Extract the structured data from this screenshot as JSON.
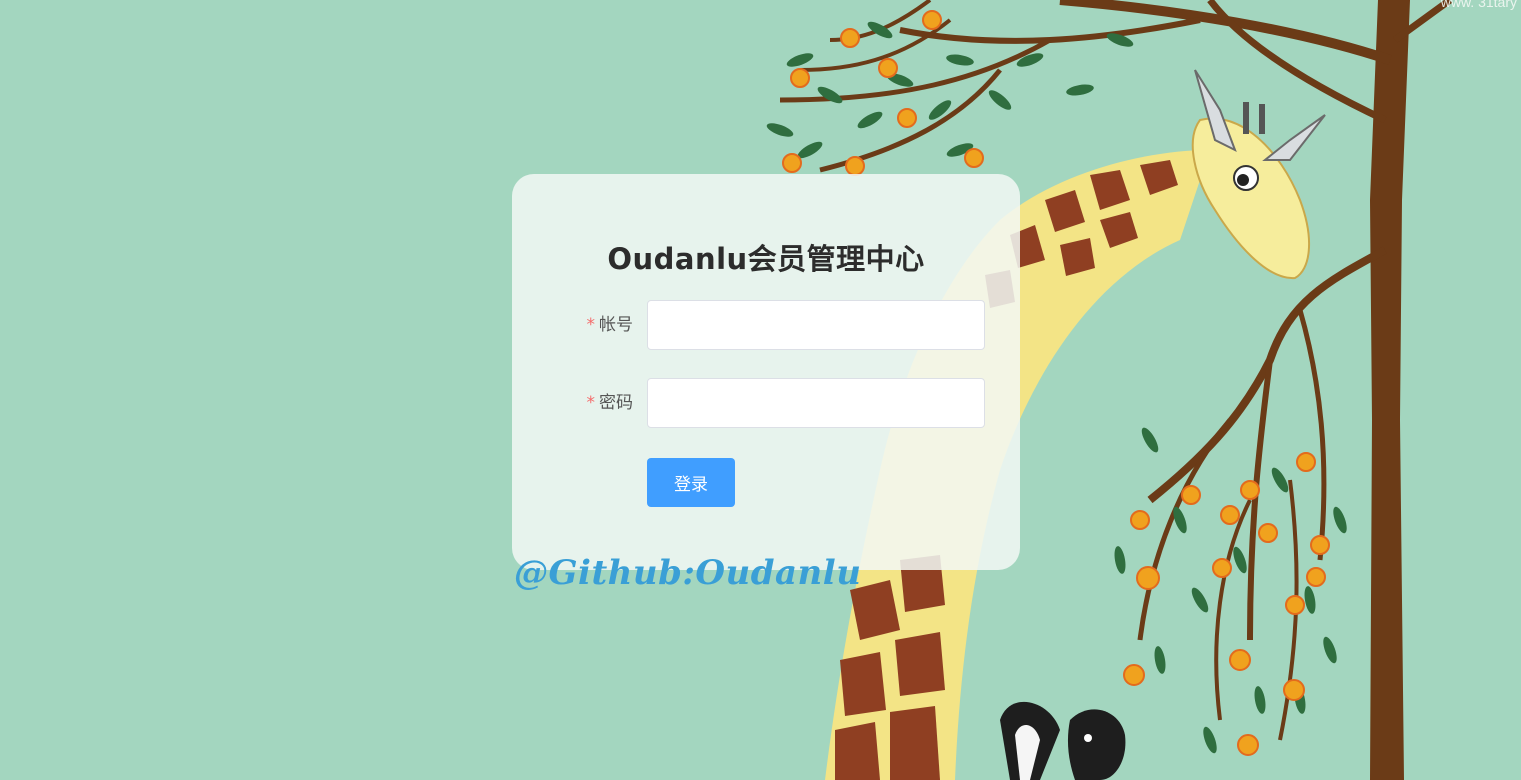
{
  "background": {
    "color": "#a3d6bf",
    "watermark": "www. 31tary"
  },
  "login": {
    "title": "Oudanlu会员管理中心",
    "account": {
      "required_mark": "*",
      "label": "帐号",
      "value": "",
      "placeholder": ""
    },
    "password": {
      "required_mark": "*",
      "label": "密码",
      "value": "",
      "placeholder": ""
    },
    "submit_label": "登录",
    "accent_color": "#409eff",
    "required_color": "#f56c6c"
  },
  "signature": "@Github:Oudanlu"
}
